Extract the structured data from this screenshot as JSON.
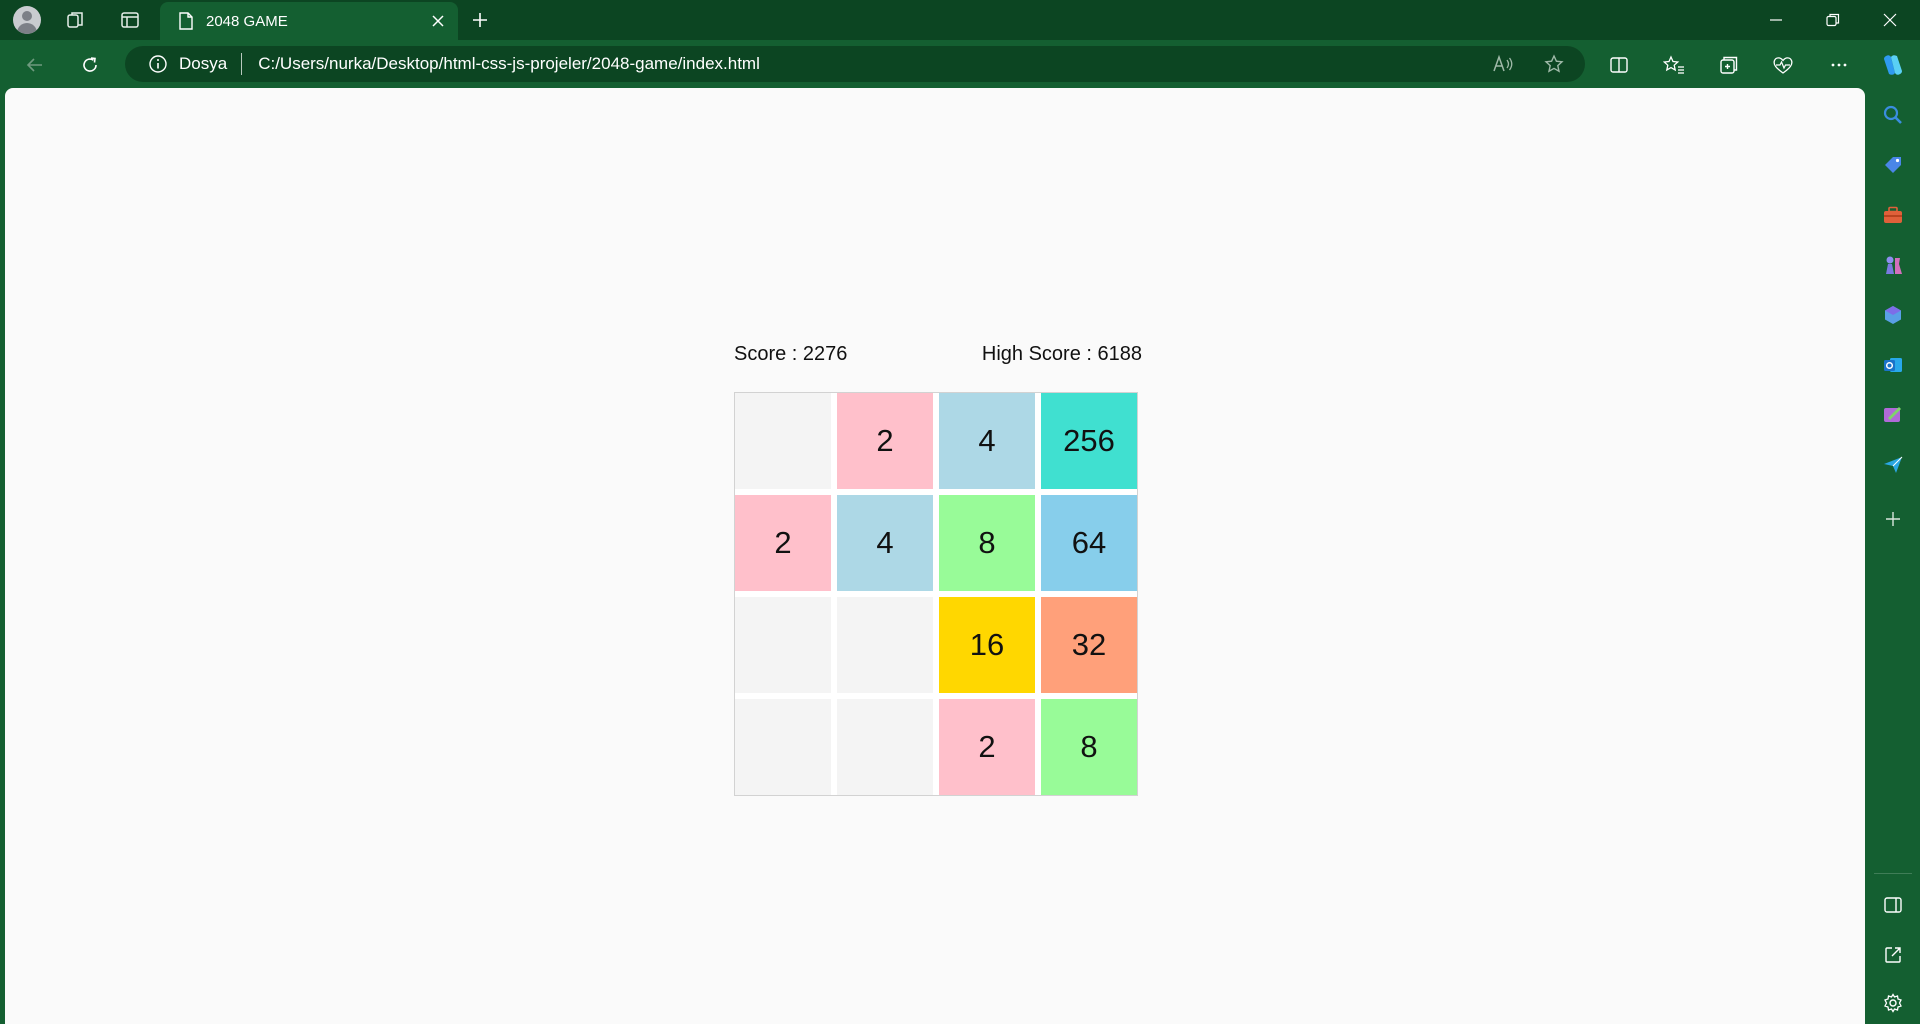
{
  "browser": {
    "tab": {
      "title": "2048 GAME"
    },
    "address": {
      "site_label": "Dosya",
      "url": "C:/Users/nurka/Desktop/html-css-js-projeler/2048-game/index.html"
    },
    "icons": {
      "profile": "profile-avatar-icon",
      "workspaces": "workspaces-icon",
      "tab_actions": "vertical-tabs-icon",
      "page": "page-icon",
      "close_tab": "close-icon",
      "new_tab": "plus-icon",
      "minimize": "minimize-icon",
      "restore": "restore-icon",
      "close_window": "close-icon",
      "back": "back-arrow-icon",
      "refresh": "refresh-icon",
      "info": "info-icon",
      "read_aloud": "read-aloud-icon",
      "favorite": "star-icon",
      "split_screen": "split-screen-icon",
      "favorites": "favorites-icon",
      "collections": "collections-icon",
      "browser_essentials": "heart-pulse-icon",
      "more": "more-icon",
      "copilot": "copilot-icon"
    },
    "sidebar": [
      {
        "name": "search-icon",
        "color": "#2e7cd6"
      },
      {
        "name": "shopping-tag-icon",
        "color": "#4a86e8"
      },
      {
        "name": "tools-icon",
        "color": "#e0603a"
      },
      {
        "name": "games-icon",
        "color": "#8e8ef0"
      },
      {
        "name": "microsoft-365-icon",
        "color": "#5aa0e6"
      },
      {
        "name": "outlook-icon",
        "color": "#1a73c9"
      },
      {
        "name": "designer-icon",
        "color": "#b06ad8"
      },
      {
        "name": "send-icon",
        "color": "#2aa7e3"
      },
      {
        "name": "add-icon",
        "color": "#d9e6dd"
      }
    ],
    "sidebar_bottom": [
      {
        "name": "sidebar-toggle-icon"
      },
      {
        "name": "open-external-icon"
      },
      {
        "name": "settings-icon"
      }
    ],
    "colors": {
      "frame": "#145f31",
      "titlebar": "#0c4522"
    }
  },
  "game": {
    "score_text": "Score : 2276",
    "high_score_text": "High Score : 6188",
    "board": [
      [
        "",
        "2",
        "4",
        "256"
      ],
      [
        "2",
        "4",
        "8",
        "64"
      ],
      [
        "",
        "",
        "16",
        "32"
      ],
      [
        "",
        "",
        "2",
        "8"
      ]
    ],
    "tile_colors": {
      "empty": "#f4f4f4",
      "2": "#ffc0cb",
      "4": "#add8e6",
      "8": "#98fb98",
      "16": "#ffd700",
      "32": "#ffa07a",
      "64": "#87ceeb",
      "256": "#40e0d0"
    }
  }
}
